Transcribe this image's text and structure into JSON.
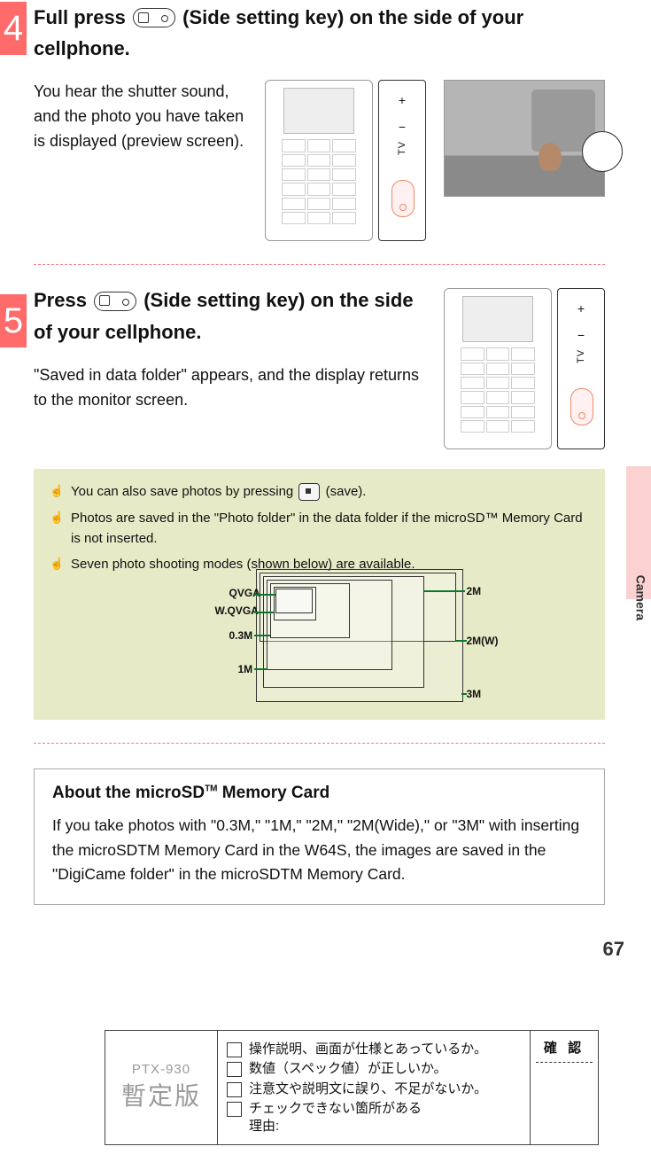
{
  "step4": {
    "num": "4",
    "heading_before": "Full press ",
    "heading_after": " (Side setting key) on the side of your cellphone.",
    "body": "You hear the shutter sound, and the photo you have taken is displayed (preview screen)."
  },
  "step5": {
    "num": "5",
    "heading_before": "Press ",
    "heading_after": " (Side setting key) on the side of your cellphone.",
    "body": "\"Saved in data folder\" appears, and the display returns to the monitor screen."
  },
  "tips": {
    "t1_before": "You can also save photos by pressing ",
    "t1_after": " (save).",
    "t2": "Photos are saved in the \"Photo folder\" in the data folder if the microSD™ Memory Card is not inserted.",
    "t3": "Seven photo shooting modes (shown below) are available."
  },
  "modes": {
    "qvga": "QVGA",
    "wqvga": "W.QVGA",
    "m03": "0.3M",
    "m1": "1M",
    "m2": "2M",
    "m2w": "2M(W)",
    "m3": "3M"
  },
  "about": {
    "title_before": "About the microSD",
    "title_tm": "TM",
    "title_after": " Memory Card",
    "body": "If you take photos with \"0.3M,\" \"1M,\" \"2M,\" \"2M(Wide),\" or \"3M\" with inserting the microSDTM Memory Card in the W64S, the images are saved in the \"DigiCame folder\" in the microSDTM Memory Card."
  },
  "side_label": "Camera",
  "page_number": "67",
  "footer": {
    "code": "PTX-930",
    "prov": "暫定版",
    "c1": "操作説明、画面が仕様とあっているか。",
    "c2": "数値（スペック値）が正しいか。",
    "c3": "注意文や説明文に誤り、不足がないか。",
    "c4": "チェックできない箇所がある",
    "c4b": "理由:",
    "confirm": "確 認"
  }
}
